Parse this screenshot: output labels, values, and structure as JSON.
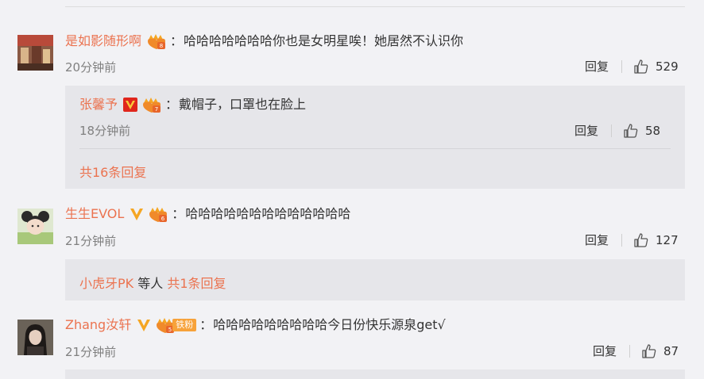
{
  "comments": [
    {
      "user": "是如影随形啊",
      "text": "哈哈哈哈哈哈哈你也是女明星唉！她居然不认识你",
      "time": "20分钟前",
      "reply_label": "回复",
      "likes": "529",
      "sub_reply": {
        "user": "张馨予",
        "text": "戴帽子，口罩也在脸上",
        "time": "18分钟前",
        "reply_label": "回复",
        "likes": "58"
      },
      "more_replies": "共16条回复"
    },
    {
      "user": "生生EVOL",
      "text": "哈哈哈哈哈哈哈哈哈哈哈哈哈",
      "time": "21分钟前",
      "reply_label": "回复",
      "likes": "127",
      "replies_summary": {
        "user": "小虎牙PK",
        "middle": "等人",
        "link": "共1条回复"
      }
    },
    {
      "user": "Zhang汝轩",
      "fan_badge": "铁粉",
      "fan_level": "5",
      "text": "哈哈哈哈哈哈哈哈哈今日份快乐源泉get√",
      "time": "21分钟前",
      "reply_label": "回复",
      "likes": "87"
    }
  ],
  "colors": {
    "username": "#eb7350",
    "background": "#f2f2f5",
    "subbox": "#e6e6ea",
    "verified_gold": "#f5a623",
    "verified_red": "#e0261c"
  },
  "icons": [
    "crown-heart-icon",
    "verified-v-icon",
    "like-thumb-icon",
    "avatar-image"
  ]
}
